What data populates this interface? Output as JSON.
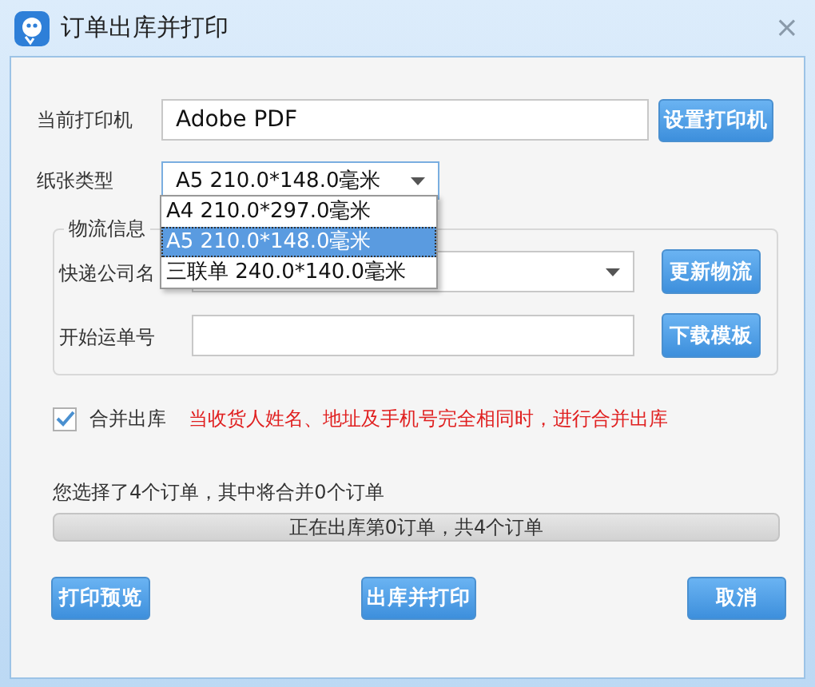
{
  "window": {
    "title": "订单出库并打印",
    "close": "×"
  },
  "printer": {
    "label": "当前打印机",
    "value": "Adobe PDF",
    "button": "设置打印机"
  },
  "paper": {
    "label": "纸张类型",
    "value": "A5  210.0*148.0毫米",
    "expanded": true,
    "options": [
      {
        "label": "A4  210.0*297.0毫米",
        "selected": false
      },
      {
        "label": "A5  210.0*148.0毫米",
        "selected": true
      },
      {
        "label": "三联单  240.0*140.0毫米",
        "selected": false
      }
    ]
  },
  "logistics": {
    "legend": "物流信息",
    "courier_label": "快递公司名",
    "courier_button": "更新物流",
    "waybill_label": "开始运单号",
    "waybill_button": "下载模板"
  },
  "merge": {
    "label": "合并出库",
    "checked": true,
    "note": "当收货人姓名、地址及手机号完全相同时，进行合并出库"
  },
  "summary": "您选择了4个订单，其中将合并0个订单",
  "progress": {
    "text": "正在出库第0订单，共4个订单",
    "level": 0
  },
  "buttons": [
    "打印预览",
    "出库并打印",
    "取消"
  ]
}
